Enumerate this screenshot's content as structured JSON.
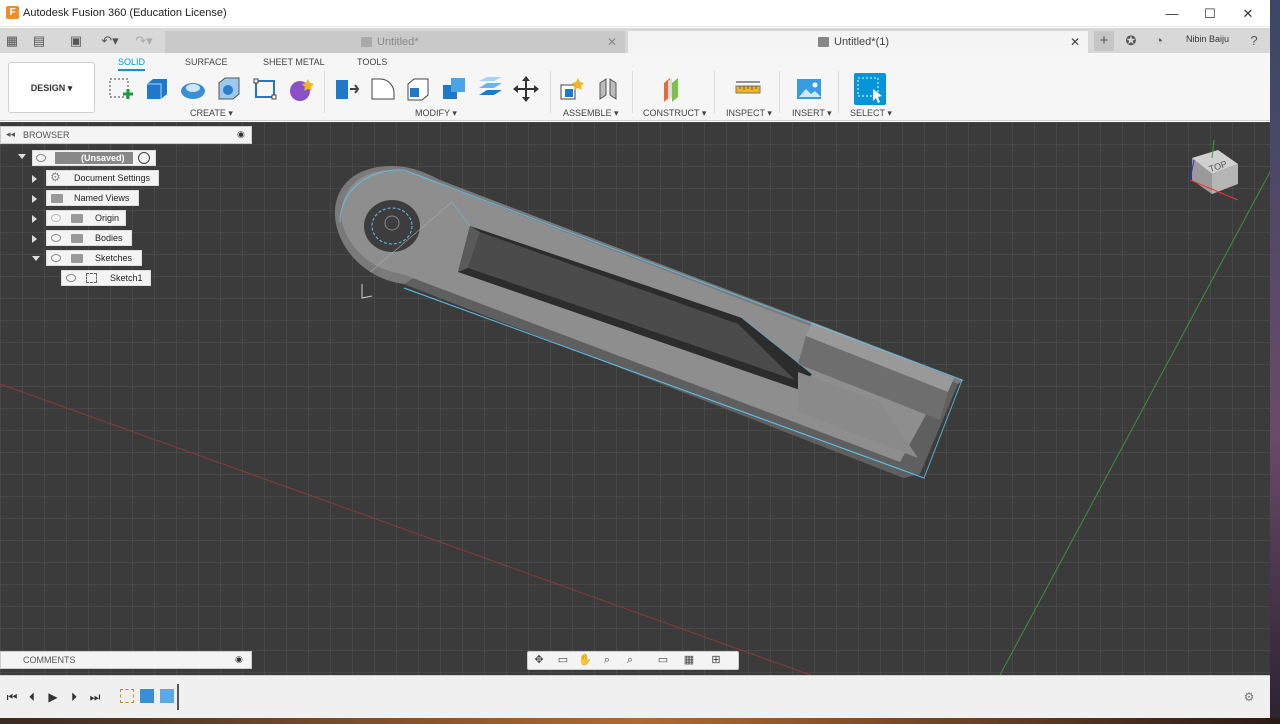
{
  "window": {
    "title": "Autodesk Fusion 360 (Education License)",
    "app_icon_letter": "F",
    "controls": {
      "minimize": "—",
      "maximize": "☐",
      "close": "✕"
    }
  },
  "tabs": [
    {
      "label": "Untitled*",
      "close": "✕",
      "active": false
    },
    {
      "label": "Untitled*(1)",
      "close": "✕",
      "active": true
    }
  ],
  "user": {
    "name": "Nibin Baiju"
  },
  "toolbar": {
    "workspace_button": "DESIGN ▾",
    "workspace_tabs": [
      "SOLID",
      "SURFACE",
      "SHEET METAL",
      "TOOLS"
    ],
    "groups": [
      "CREATE ▾",
      "MODIFY ▾",
      "ASSEMBLE ▾",
      "CONSTRUCT ▾",
      "INSPECT ▾",
      "INSERT ▾",
      "SELECT ▾"
    ]
  },
  "browser": {
    "header": "BROWSER",
    "collapse_icon": "◂◂",
    "pin_icon": "◉",
    "items": [
      {
        "label": "(Unsaved)"
      },
      {
        "label": "Document Settings"
      },
      {
        "label": "Named Views"
      },
      {
        "label": "Origin"
      },
      {
        "label": "Bodies"
      },
      {
        "label": "Sketches"
      },
      {
        "label": "Sketch1"
      }
    ]
  },
  "comments": {
    "header": "COMMENTS",
    "pin_icon": "◉"
  },
  "viewcube": {
    "face_label": "TOP"
  },
  "colors": {
    "accent": "#0696d7",
    "viewport_bg": "#3b3b3b",
    "model_body": "#8a8a8a",
    "edge_highlight": "#5ec8f5"
  }
}
